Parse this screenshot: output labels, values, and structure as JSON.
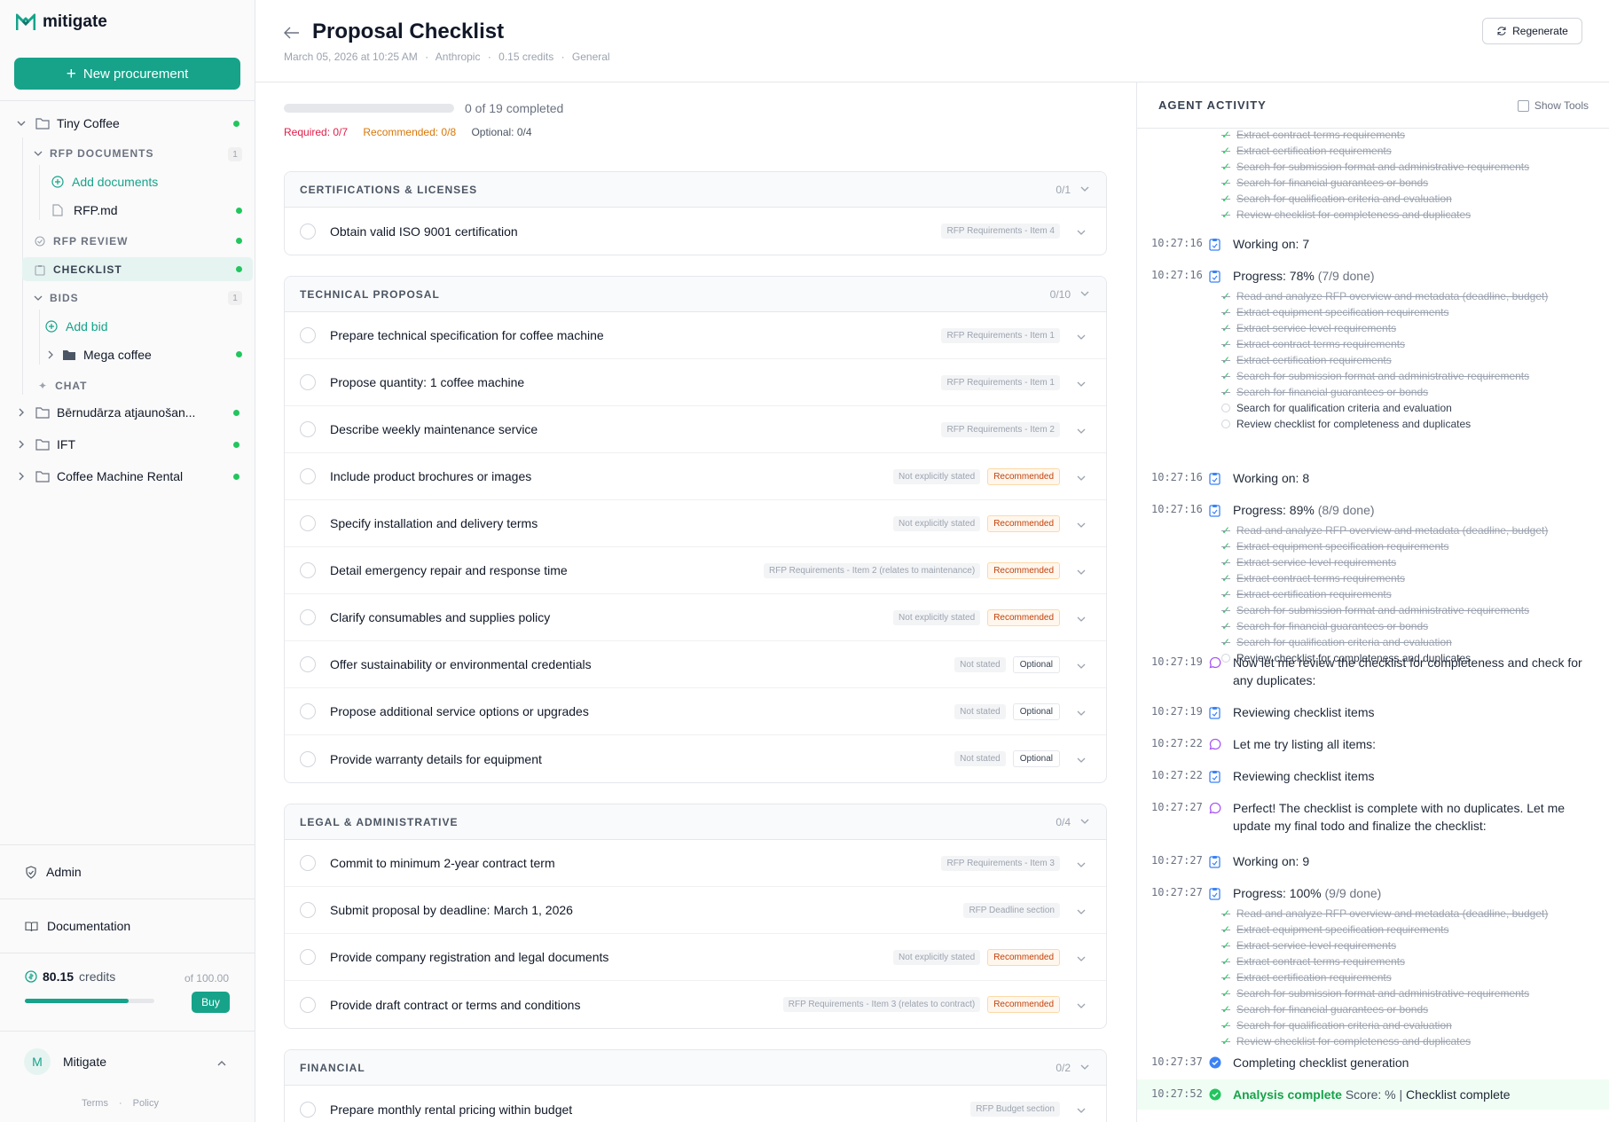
{
  "app": {
    "name": "mitigate",
    "new_button": "New procurement"
  },
  "sidebar": {
    "project": "Tiny Coffee",
    "rfp_documents": {
      "label": "RFP DOCUMENTS",
      "count": "1",
      "add": "Add documents",
      "file": "RFP.md"
    },
    "rfp_review": "RFP REVIEW",
    "checklist": "CHECKLIST",
    "bids": {
      "label": "BIDS",
      "count": "1",
      "add": "Add bid",
      "bid": "Mega coffee"
    },
    "chat": "CHAT",
    "projects": [
      "Bērnudārza atjaunošan...",
      "IFT",
      "Coffee Machine Rental"
    ],
    "admin": "Admin",
    "documentation": "Documentation",
    "credits": {
      "value": "80.15",
      "label": "credits",
      "of": "of 100.00",
      "fraction": 0.8015,
      "buy": "Buy"
    },
    "user": {
      "initial": "M",
      "name": "Mitigate"
    },
    "terms": "Terms",
    "dot": "·",
    "policy": "Policy"
  },
  "header": {
    "title": "Proposal Checklist",
    "date": "March 05, 2026 at 10:25 AM",
    "provider": "Anthropic",
    "cost": "0.15 credits",
    "type": "General",
    "sep": "·",
    "regenerate": "Regenerate"
  },
  "progress": {
    "text": "0 of 19 completed",
    "fraction": 0,
    "required": "Required: 0/7",
    "recommended": "Recommended: 0/8",
    "optional": "Optional: 0/4"
  },
  "sections": [
    {
      "title": "CERTIFICATIONS & LICENSES",
      "count": "0/1",
      "items": [
        {
          "text": "Obtain valid ISO 9001 certification",
          "source": "RFP Requirements - Item 4",
          "badge": ""
        }
      ]
    },
    {
      "title": "TECHNICAL PROPOSAL",
      "count": "0/10",
      "items": [
        {
          "text": "Prepare technical specification for coffee machine",
          "source": "RFP Requirements - Item 1",
          "badge": ""
        },
        {
          "text": "Propose quantity: 1 coffee machine",
          "source": "RFP Requirements - Item 1",
          "badge": ""
        },
        {
          "text": "Describe weekly maintenance service",
          "source": "RFP Requirements - Item 2",
          "badge": ""
        },
        {
          "text": "Include product brochures or images",
          "source": "Not explicitly stated",
          "badge": "Recommended"
        },
        {
          "text": "Specify installation and delivery terms",
          "source": "Not explicitly stated",
          "badge": "Recommended"
        },
        {
          "text": "Detail emergency repair and response time",
          "source": "RFP Requirements - Item 2 (relates to maintenance)",
          "badge": "Recommended"
        },
        {
          "text": "Clarify consumables and supplies policy",
          "source": "Not explicitly stated",
          "badge": "Recommended"
        },
        {
          "text": "Offer sustainability or environmental credentials",
          "source": "Not stated",
          "badge": "Optional"
        },
        {
          "text": "Propose additional service options or upgrades",
          "source": "Not stated",
          "badge": "Optional"
        },
        {
          "text": "Provide warranty details for equipment",
          "source": "Not stated",
          "badge": "Optional"
        }
      ]
    },
    {
      "title": "LEGAL & ADMINISTRATIVE",
      "count": "0/4",
      "items": [
        {
          "text": "Commit to minimum 2-year contract term",
          "source": "RFP Requirements - Item 3",
          "badge": ""
        },
        {
          "text": "Submit proposal by deadline: March 1, 2026",
          "source": "RFP Deadline section",
          "badge": ""
        },
        {
          "text": "Provide company registration and legal documents",
          "source": "Not explicitly stated",
          "badge": "Recommended"
        },
        {
          "text": "Provide draft contract or terms and conditions",
          "source": "RFP Requirements - Item 3 (relates to contract)",
          "badge": "Recommended"
        }
      ]
    },
    {
      "title": "FINANCIAL",
      "count": "0/2",
      "items": [
        {
          "text": "Prepare monthly rental pricing within budget",
          "source": "RFP Budget section",
          "badge": ""
        }
      ]
    }
  ],
  "agent": {
    "title": "AGENT ACTIVITY",
    "show_tools": "Show Tools",
    "tasks": [
      "Read and analyze RFP overview and metadata (deadline, budget)",
      "Extract equipment specification requirements",
      "Extract service level requirements",
      "Extract contract terms requirements",
      "Extract certification requirements",
      "Search for submission format and administrative requirements",
      "Search for financial guarantees or bonds",
      "Search for qualification criteria and evaluation",
      "Review checklist for completeness and duplicates"
    ],
    "top_list_done": 6,
    "events": [
      {
        "time": "10:27:16",
        "icon": "clipboard",
        "text": "Working on: 7"
      },
      {
        "time": "10:27:16",
        "icon": "clipboard",
        "text": "Progress: 78%",
        "pct": "(7/9 done)",
        "done": 7
      },
      {
        "time": "10:27:16",
        "icon": "clipboard",
        "text": "Working on: 8"
      },
      {
        "time": "10:27:16",
        "icon": "clipboard",
        "text": "Progress: 89%",
        "pct": "(8/9 done)",
        "done": 8
      },
      {
        "time": "10:27:19",
        "icon": "message",
        "text": "Now let me review the checklist for completeness and check for any duplicates:"
      },
      {
        "time": "10:27:19",
        "icon": "clipboard",
        "text": "Reviewing checklist items"
      },
      {
        "time": "10:27:22",
        "icon": "message",
        "text": "Let me try listing all items:"
      },
      {
        "time": "10:27:22",
        "icon": "clipboard",
        "text": "Reviewing checklist items"
      },
      {
        "time": "10:27:27",
        "icon": "message",
        "text": "Perfect! The checklist is complete with no duplicates. Let me update my final todo and finalize the checklist:"
      },
      {
        "time": "10:27:27",
        "icon": "clipboard",
        "text": "Working on: 9"
      },
      {
        "time": "10:27:27",
        "icon": "clipboard",
        "text": "Progress: 100%",
        "pct": "(9/9 done)",
        "done": 9
      },
      {
        "time": "10:27:37",
        "icon": "check-circle-blue",
        "text": "Completing checklist generation"
      },
      {
        "time": "10:27:52",
        "icon": "check-circle-green",
        "text": "Analysis complete",
        "extra": "Score: % |",
        "tail": "Checklist complete"
      }
    ]
  },
  "colors": {
    "brand": "#16a38a",
    "required": "#e11d48",
    "recommended": "#d97706",
    "done": "#22c55e"
  }
}
